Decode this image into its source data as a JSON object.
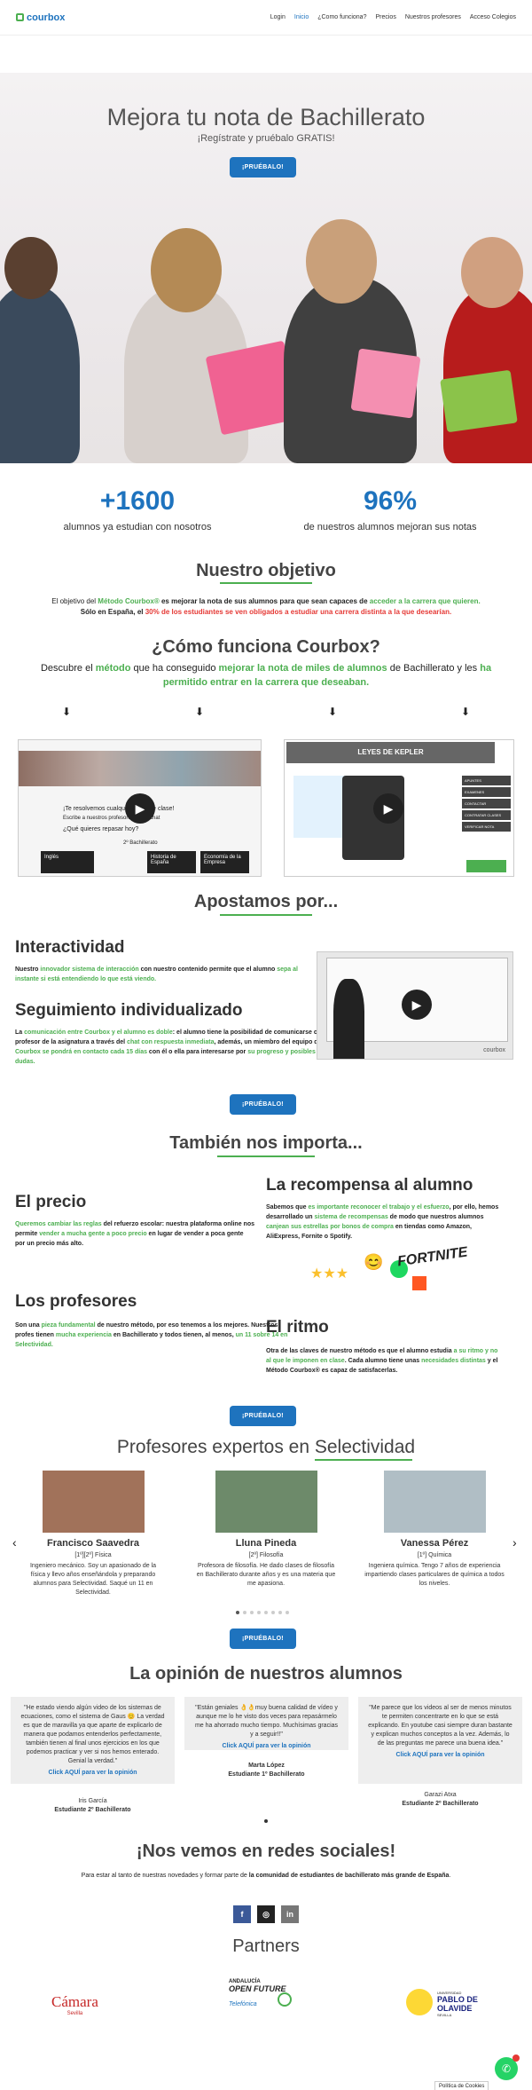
{
  "header": {
    "logo": "courbox",
    "nav": [
      "Login",
      "Inicio",
      "¿Como funciona?",
      "Precios",
      "Nuestros profesores",
      "Acceso Colegios"
    ]
  },
  "hero": {
    "title": "Mejora tu nota de Bachillerato",
    "subtitle": "¡Regístrate y pruébalo GRATIS!",
    "cta": "¡PRUÉBALO!"
  },
  "stats": [
    {
      "value": "+1600",
      "label": "alumnos ya estudian con nosotros"
    },
    {
      "value": "96%",
      "label": "de nuestros alumnos mejoran sus notas"
    }
  ],
  "objetivo": {
    "title": "Nuestro objetivo",
    "p1a": "El objetivo del ",
    "p1b": "Método Courbox®",
    "p1c": " es mejorar la nota de sus alumnos para que sean capaces de ",
    "p1d": "acceder a la carrera que quieren.",
    "p2a": "Sólo en España, el ",
    "p2b": "30% de los estudiantes se ven obligados a estudiar una carrera distinta a la que desearían."
  },
  "como": {
    "title": "¿Cómo funciona Courbox?",
    "t1": "Descubre el ",
    "t2": "método",
    "t3": " que ha conseguido ",
    "t4": "mejorar la nota de miles de alumnos",
    "t5": " de Bachillerato y les ",
    "t6": "ha permitido entrar en la carrera que deseaban.",
    "video1_text": "¡Te resolvemos cualquier duda de clase!",
    "video1_sub": "Escribe a nuestros profesores por el chat",
    "video1_q": "¿Qué quieres repasar hoy?",
    "video1_tag": "2º Bachillerato",
    "video1_courses": [
      "Inglés",
      "Historia de España",
      "Economía de la Empresa"
    ],
    "video2_title": "LEYES DE KEPLER",
    "video2_menu": [
      "APUNTES",
      "EXAMENES",
      "CONTACTAR",
      "CONTRATAR CLASES",
      "VERIFICAR NOTA"
    ]
  },
  "apostamos": {
    "title": "Apostamos por...",
    "f1_title": "Interactividad",
    "f1_a": "Nuestro ",
    "f1_b": "innovador sistema de interacción",
    "f1_c": " con nuestro contenido permite que el alumno ",
    "f1_d": "sepa al instante si está entendiendo lo que está viendo.",
    "f2_title": "Seguimiento individualizado",
    "f2_a": "La ",
    "f2_b": "comunicación entre Courbox y el alumno es doble",
    "f2_c": ": el alumno tiene la posibilidad de comunicarse con el profesor de la asignatura a través del ",
    "f2_d": "chat con respuesta inmediata",
    "f2_e": ", además, un miembro del equipo de ",
    "f2_f": "Courbox se pondrá en contacto cada 15 días",
    "f2_g": " con él o ella para interesarse por ",
    "f2_h": "su progreso y posibles dudas.",
    "cta": "¡PRUÉBALO!",
    "video_brand": "courbox"
  },
  "importa": {
    "title": "También nos importa...",
    "precio_title": "El precio",
    "precio_a": "Queremos cambiar las reglas",
    "precio_b": " del refuerzo escolar: nuestra plataforma online nos permite ",
    "precio_c": "vender a mucha gente a poco precio",
    "precio_d": " en lugar de vender a poca gente por un precio más alto.",
    "recomp_title": "La recompensa al alumno",
    "recomp_a": "Sabemos que ",
    "recomp_b": "es importante reconocer el trabajo y el esfuerzo",
    "recomp_c": ", por ello, hemos desarrollado un ",
    "recomp_d": "sistema de recompensas",
    "recomp_e": " de modo que nuestros alumnos ",
    "recomp_f": "canjean sus estrellas por bonos de compra",
    "recomp_g": " en tiendas como Amazon, AliExpress, Fornite o Spotify.",
    "fortnite": "FORTNITE",
    "prof_title": "Los profesores",
    "prof_a": "Son una ",
    "prof_b": "pieza fundamental",
    "prof_c": " de nuestro método, por eso tenemos a los mejores. Nuestros profes tienen ",
    "prof_d": "mucha experiencia",
    "prof_e": " en Bachillerato y todos tienen, al menos, ",
    "prof_f": "un 11 sobre 14 en Selectividad.",
    "ritmo_title": "El ritmo",
    "ritmo_a": "Otra de las claves de nuestro método es que el alumno estudia ",
    "ritmo_b": "a su ritmo y no al que le imponen en clase",
    "ritmo_c": ". Cada alumno tiene unas ",
    "ritmo_d": "necesidades distintas",
    "ritmo_e": " y el Método Courbox® es capaz de satisfacerlas.",
    "cta": "¡PRUÉBALO!"
  },
  "profesores": {
    "title_a": "Profesores expertos en ",
    "title_b": "Selectividad",
    "items": [
      {
        "name": "Francisco Saavedra",
        "role": "[1º][2º] Física",
        "desc": "Ingeniero mecánico. Soy un apasionado de la física y llevo años enseñándola y preparando alumnos para Selectividad. Saqué un 11 en Selectividad."
      },
      {
        "name": "Lluna Pineda",
        "role": "[2º] Filosofía",
        "desc": "Profesora de filosofía. He dado clases de filosofía en Bachillerato durante años y es una materia que me apasiona."
      },
      {
        "name": "Vanessa Pérez",
        "role": "[1º] Química",
        "desc": "Ingeniera química. Tengo 7 años de experiencia impartiendo clases particulares de química a todos los niveles."
      }
    ],
    "prev": "‹",
    "next": "›",
    "cta": "¡PRUÉBALO!"
  },
  "opinion": {
    "title": "La opinión de nuestros alumnos",
    "items": [
      {
        "text": "\"He estado viendo algún video de los sistemas de ecuaciones, como el sistema de Gaus 😊 La verdad es que de maravilla ya que aparte de explicarlo de manera que podamos entenderlos perfectamente, también tienen al final unos ejercicios en los que podemos practicar y ver si nos hemos enterado. Genial la verdad.\"",
        "link": "Click AQUÍ para ver la opinión",
        "author": "Iris García",
        "course": "Estudiante 2º Bachillerato"
      },
      {
        "text": "\"Están geniales 👌👌muy buena calidad de vídeo y aunque me lo he visto dos veces para repasármelo me ha ahorrado mucho tiempo. Muchísimas gracias y a seguir!!\"",
        "link": "Click AQUÍ para ver la opinión",
        "author": "Marta López",
        "course": "Estudiante 1º Bachillerato"
      },
      {
        "text": "\"Me parece que los videos al ser de menos minutos te permiten concentrarte en lo que se está explicando. En youtube casi siempre duran bastante y explican muchos conceptos a la vez. Además, lo de las preguntas me parece una buena idea.\"",
        "link": "Click AQUÍ para ver la opinión",
        "author": "Garazi Atxa",
        "course": "Estudiante 2º Bachillerato"
      }
    ]
  },
  "redes": {
    "title": "¡Nos vemos en redes sociales!",
    "text_a": "Para estar al tanto de nuestras novedades y formar parte de ",
    "text_b": "la comunidad de estudiantes de bachillerato más grande de España",
    "text_c": ".",
    "icons": [
      "f",
      "◎",
      "in"
    ]
  },
  "partners": {
    "title": "Partners",
    "items": [
      "Cámara",
      "Sevilla",
      "ANDALUCÍA",
      "OPEN FUTURE",
      "Telefónica",
      "UNIVERSIDAD",
      "PABLO DE OLAVIDE",
      "SEVILLA"
    ]
  },
  "footer": {
    "cookies": "Política de Cookies"
  },
  "colors": {
    "accent": "#1e73be",
    "green": "#4caf50",
    "red": "#e53935"
  }
}
